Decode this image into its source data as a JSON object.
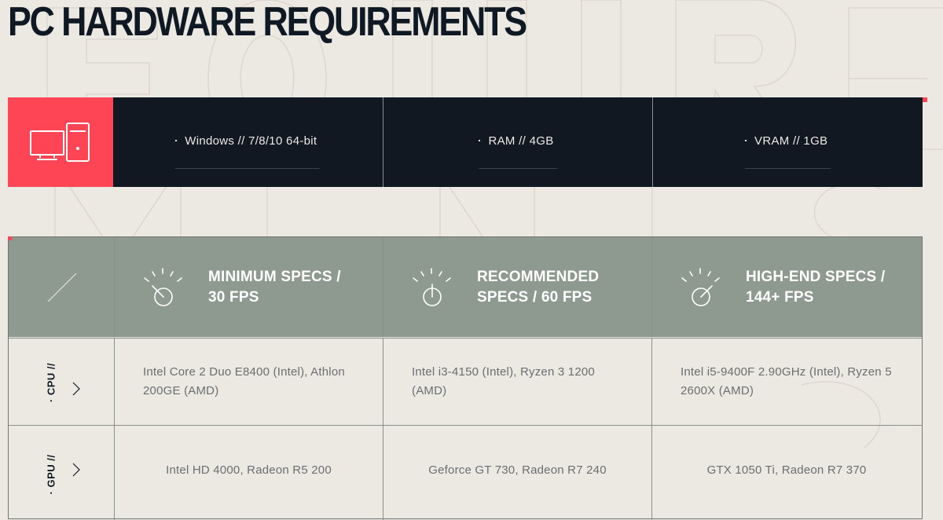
{
  "page": {
    "title": "PC HARDWARE REQUIREMENTS",
    "colors": {
      "background": "#ece8e2",
      "accent": "#fd4556",
      "dark": "#111822",
      "header_gray": "#8e998f",
      "text_muted": "#6b6f72"
    }
  },
  "os_bar": {
    "icon": "desktop-computer-icon",
    "items": [
      {
        "label": "Windows // 7/8/10 64-bit"
      },
      {
        "label": "RAM // 4GB"
      },
      {
        "label": "VRAM // 1GB"
      }
    ]
  },
  "specs": {
    "tiers": [
      {
        "title": "MINIMUM SPECS / 30 FPS",
        "icon": "gauge-low-icon"
      },
      {
        "title": "RECOMMENDED SPECS / 60 FPS",
        "icon": "gauge-mid-icon"
      },
      {
        "title": "HIGH-END SPECS / 144+ FPS",
        "icon": "gauge-high-icon"
      }
    ],
    "rows": [
      {
        "label": "· CPU //",
        "values": [
          "Intel Core 2 Duo E8400 (Intel), Athlon 200GE (AMD)",
          "Intel i3-4150 (Intel), Ryzen 3 1200 (AMD)",
          "Intel i5-9400F 2.90GHz (Intel), Ryzen 5 2600X (AMD)"
        ]
      },
      {
        "label": "· GPU //",
        "values": [
          "Intel HD 4000, Radeon R5 200",
          "Geforce GT 730, Radeon R7 240",
          "GTX 1050 Ti, Radeon R7 370"
        ]
      }
    ]
  }
}
